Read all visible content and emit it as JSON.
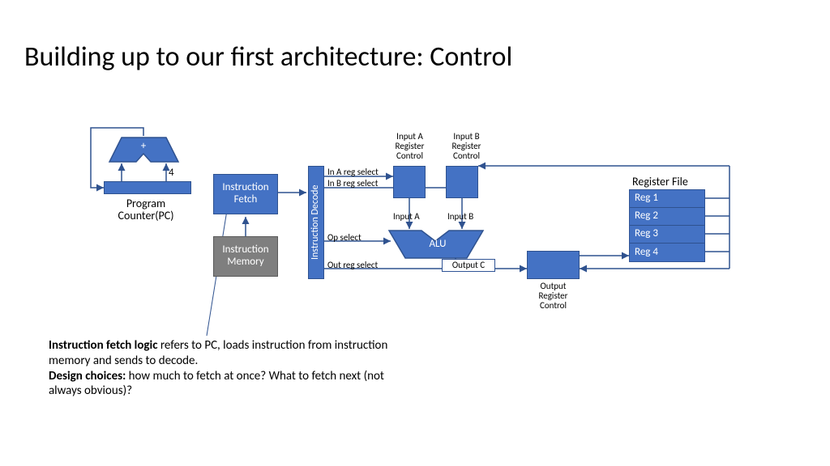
{
  "title": "Building up to our first architecture: Control",
  "adder": {
    "symbol": "+"
  },
  "constant_4": "4",
  "pc_label": "Program Counter(PC)",
  "ifetch": "Instruction Fetch",
  "imem": "Instruction Memory",
  "idecode": "Instruction Decode",
  "inA_ctrl": "Input A Register Control",
  "inB_ctrl": "Input B Register Control",
  "inA_sel": "In A reg select",
  "inB_sel": "In B reg select",
  "inputA": "Input A",
  "inputB": "Input B",
  "op_sel": "Op select",
  "alu": "ALU",
  "outputC": "Output C",
  "out_sel": "Out reg select",
  "out_ctrl": "Output Register Control",
  "regfile_title": "Register File",
  "regs": [
    "Reg 1",
    "Reg 2",
    "Reg 3",
    "Reg 4"
  ],
  "caption": {
    "p1_bold": "Instruction fetch logic",
    "p1_rest": " refers to PC, loads instruction from instruction memory and sends to decode.",
    "p2_bold": "Design choices:",
    "p2_rest": " how much to fetch at once? What to fetch next (not always obvious)?"
  }
}
